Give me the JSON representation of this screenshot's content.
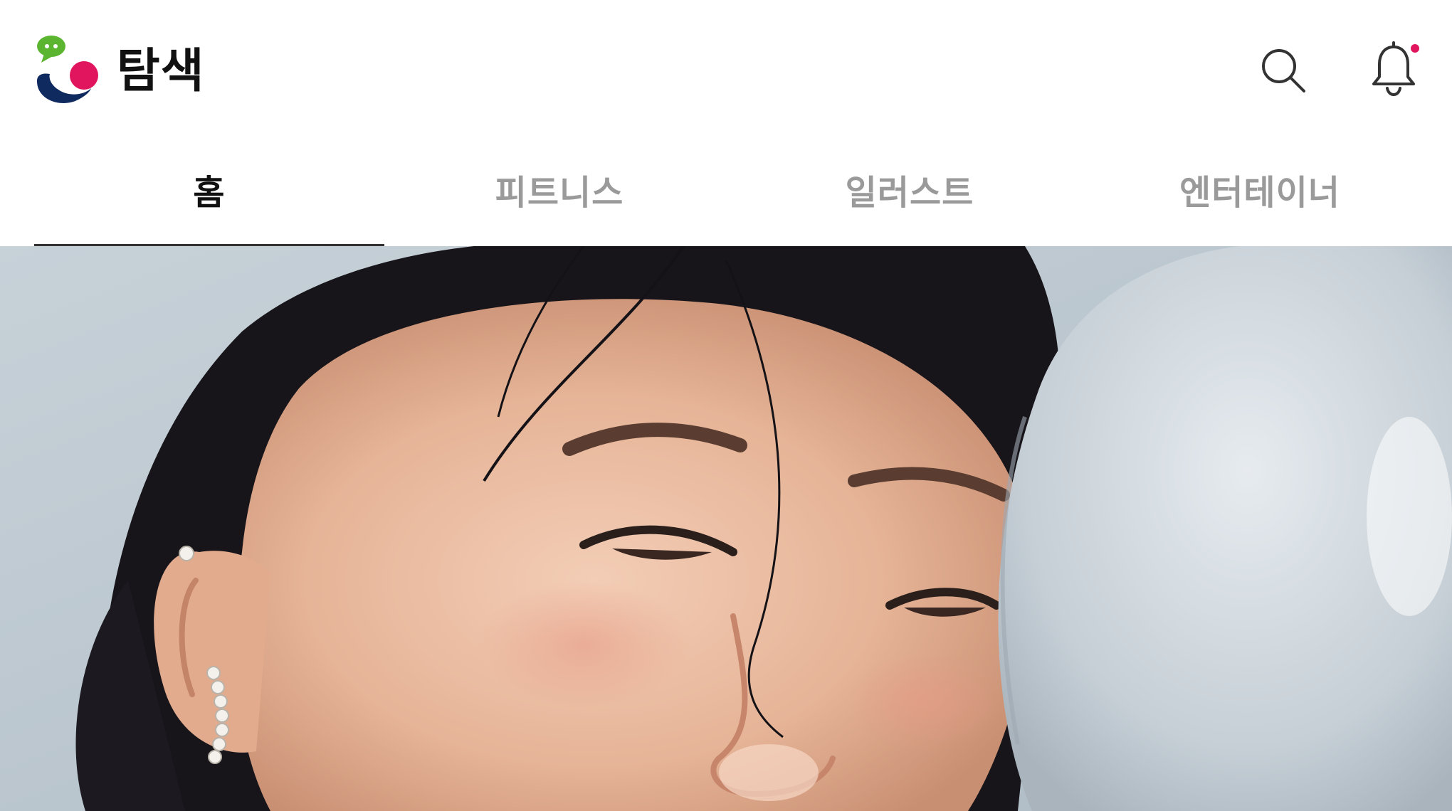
{
  "header": {
    "title": "탐색",
    "logo_icon": "app-logo-icon",
    "search_icon": "search-icon",
    "bell_icon": "bell-icon",
    "has_notification_dot": true
  },
  "tabs": [
    {
      "label": "홈",
      "active": true
    },
    {
      "label": "피트니스",
      "active": false
    },
    {
      "label": "일러스트",
      "active": false
    },
    {
      "label": "엔터테이너",
      "active": false
    }
  ],
  "colors": {
    "accent": "#e0155e",
    "logo_green": "#5cb531",
    "logo_navy": "#0f2a5e",
    "tab_active": "#111111",
    "tab_inactive": "#9a9a9a"
  },
  "hero": {
    "icon": "hero-photo-image"
  }
}
